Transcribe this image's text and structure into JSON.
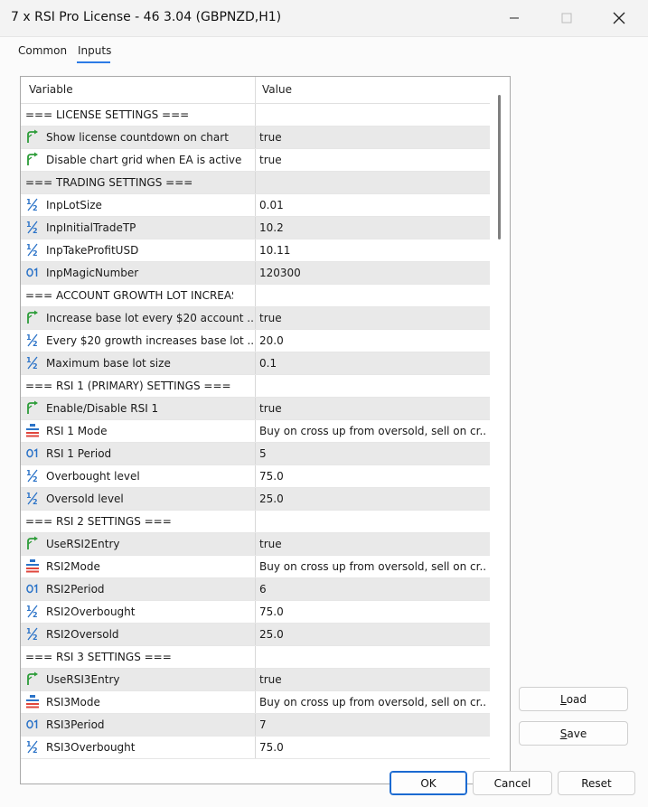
{
  "window": {
    "title": "7 x RSI Pro License - 46 3.04 (GBPNZD,H1)",
    "minimize_glyph": "—",
    "maximize_glyph": "☐",
    "close_glyph": "✕"
  },
  "tabs": [
    {
      "label": "Common",
      "selected": false
    },
    {
      "label": "Inputs",
      "selected": true
    }
  ],
  "table": {
    "col_variable": "Variable",
    "col_value": "Value",
    "rows": [
      {
        "variable": "=== LICENSE SETTINGS ===",
        "value": "",
        "icon": "none"
      },
      {
        "variable": "Show license countdown on chart",
        "value": "true",
        "icon": "bool-icon"
      },
      {
        "variable": "Disable chart grid when EA is active",
        "value": "true",
        "icon": "bool-icon"
      },
      {
        "variable": "=== TRADING SETTINGS ===",
        "value": "",
        "icon": "none"
      },
      {
        "variable": "InpLotSize",
        "value": "0.01",
        "icon": "double-icon"
      },
      {
        "variable": "InpInitialTradeTP",
        "value": "10.2",
        "icon": "double-icon"
      },
      {
        "variable": "InpTakeProfitUSD",
        "value": "10.11",
        "icon": "double-icon"
      },
      {
        "variable": "InpMagicNumber",
        "value": "120300",
        "icon": "int-icon"
      },
      {
        "variable": "=== ACCOUNT GROWTH LOT INCREASE ...",
        "value": "",
        "icon": "none"
      },
      {
        "variable": "Increase base lot every $20 account ...",
        "value": "true",
        "icon": "bool-icon"
      },
      {
        "variable": "Every $20 growth increases base lot ...",
        "value": "20.0",
        "icon": "double-icon"
      },
      {
        "variable": "Maximum base lot size",
        "value": "0.1",
        "icon": "double-icon"
      },
      {
        "variable": "=== RSI 1 (PRIMARY) SETTINGS ===",
        "value": "",
        "icon": "none"
      },
      {
        "variable": "Enable/Disable RSI 1",
        "value": "true",
        "icon": "bool-icon"
      },
      {
        "variable": "RSI 1 Mode",
        "value": "Buy on cross up from oversold, sell on cr...",
        "icon": "enum-icon"
      },
      {
        "variable": "RSI 1 Period",
        "value": "5",
        "icon": "int-icon"
      },
      {
        "variable": "Overbought level",
        "value": "75.0",
        "icon": "double-icon"
      },
      {
        "variable": "Oversold level",
        "value": "25.0",
        "icon": "double-icon"
      },
      {
        "variable": "=== RSI 2 SETTINGS ===",
        "value": "",
        "icon": "none"
      },
      {
        "variable": "UseRSI2Entry",
        "value": "true",
        "icon": "bool-icon"
      },
      {
        "variable": "RSI2Mode",
        "value": "Buy on cross up from oversold, sell on cr...",
        "icon": "enum-icon"
      },
      {
        "variable": "RSI2Period",
        "value": "6",
        "icon": "int-icon"
      },
      {
        "variable": "RSI2Overbought",
        "value": "75.0",
        "icon": "double-icon"
      },
      {
        "variable": "RSI2Oversold",
        "value": "25.0",
        "icon": "double-icon"
      },
      {
        "variable": "=== RSI 3 SETTINGS ===",
        "value": "",
        "icon": "none"
      },
      {
        "variable": "UseRSI3Entry",
        "value": "true",
        "icon": "bool-icon"
      },
      {
        "variable": "RSI3Mode",
        "value": "Buy on cross up from oversold, sell on cr...",
        "icon": "enum-icon"
      },
      {
        "variable": "RSI3Period",
        "value": "7",
        "icon": "int-icon"
      },
      {
        "variable": "RSI3Overbought",
        "value": "75.0",
        "icon": "double-icon"
      }
    ]
  },
  "buttons": {
    "load_first": "L",
    "load_rest": "oad",
    "save_first": "S",
    "save_rest": "ave",
    "ok": "OK",
    "cancel": "Cancel",
    "reset": "Reset"
  },
  "colors": {
    "accent": "#2c7be5",
    "bool_icon": "#2e9d3a",
    "type_icon": "#2b73c8",
    "enum_top": "#2b73c8",
    "enum_bottom": "#e0463c"
  }
}
